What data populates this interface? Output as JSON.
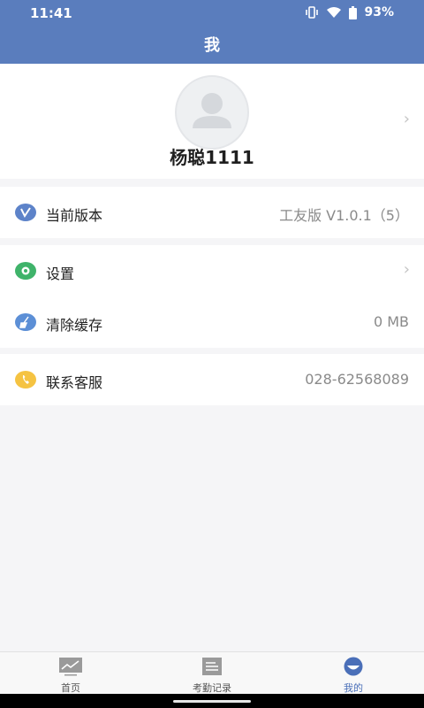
{
  "status": {
    "time": "11:41",
    "battery": "93%",
    "icons": [
      "vibrate-icon",
      "wifi-icon",
      "battery-icon"
    ]
  },
  "header": {
    "title": "我"
  },
  "profile": {
    "username": "杨聪1111"
  },
  "version": {
    "label": "当前版本",
    "value": "工友版 V1.0.1（5）"
  },
  "settings": {
    "label": "设置"
  },
  "cache": {
    "label": "清除缓存",
    "value": "0 MB"
  },
  "contact": {
    "label": "联系客服",
    "value": "028-62568089"
  },
  "nav": {
    "home": "首页",
    "attendance": "考勤记录",
    "mine": "我的"
  },
  "colors": {
    "primary": "#5a7dbd",
    "version_icon": "#5d83c9",
    "settings_icon": "#3fb36a",
    "cache_icon": "#5c8fd6",
    "contact_icon": "#f5c342",
    "active_tab": "#4a6fb8"
  }
}
